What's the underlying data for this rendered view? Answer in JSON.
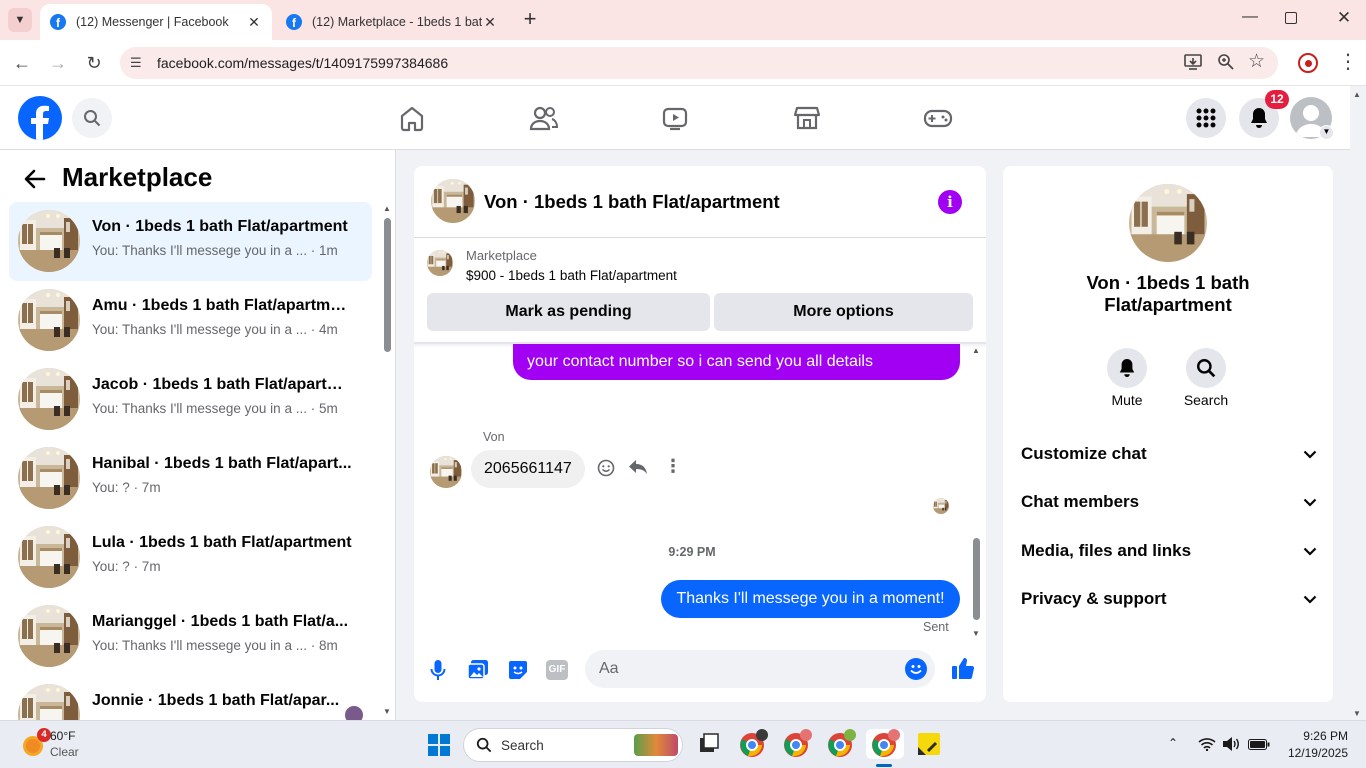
{
  "browser": {
    "tabs": [
      {
        "title": "(12) Messenger | Facebook",
        "active": true
      },
      {
        "title": "(12) Marketplace - 1beds 1 bath",
        "active": false
      }
    ],
    "url": "facebook.com/messages/t/1409175997384686"
  },
  "fb_header": {
    "notification_count": "12"
  },
  "left": {
    "title": "Marketplace",
    "conversations": [
      {
        "name": "Von · 1beds 1 bath Flat/apartment",
        "preview": "You: Thanks I'll messege you in a ...",
        "time": "· 1m"
      },
      {
        "name": "Amu · 1beds 1 bath Flat/apartment",
        "preview": "You: Thanks I'll messege you in a ...",
        "time": "· 4m"
      },
      {
        "name": "Jacob · 1beds 1 bath Flat/apartm...",
        "preview": "You: Thanks I'll messege you in a ...",
        "time": "· 5m"
      },
      {
        "name": "Hanibal · 1beds 1 bath Flat/apart...",
        "preview": "You: ?",
        "time": "· 7m"
      },
      {
        "name": "Lula · 1beds 1 bath Flat/apartment",
        "preview": "You: ?",
        "time": "· 7m"
      },
      {
        "name": "Marianggel · 1beds 1 bath Flat/a...",
        "preview": "You: Thanks I'll messege you in a ...",
        "time": "· 8m"
      },
      {
        "name": "Jonnie · 1beds 1 bath Flat/apar...",
        "preview": "",
        "time": ""
      }
    ]
  },
  "chat": {
    "title": "Von · 1beds 1 bath Flat/apartment",
    "listing_label": "Marketplace",
    "listing_title": "$900 - 1beds 1 bath Flat/apartment",
    "mark_pending": "Mark as pending",
    "more_options": "More options",
    "sent_msg_partial": "your contact number so i can send you all details",
    "sender_name": "Von",
    "received_msg": "2065661147",
    "timestamp": "9:29 PM",
    "last_msg": "Thanks I'll messege you in a moment!",
    "status": "Sent",
    "input_placeholder": "Aa"
  },
  "right": {
    "name": "Von · 1beds 1 bath Flat/apartment",
    "mute": "Mute",
    "search": "Search",
    "sections": [
      "Customize chat",
      "Chat members",
      "Media, files and links",
      "Privacy & support"
    ]
  },
  "taskbar": {
    "temp": "60°F",
    "weather": "Clear",
    "weather_badge": "4",
    "search": "Search",
    "time": "9:26 PM",
    "date": "12/19/2025"
  },
  "colors": {
    "fb_blue": "#1877f2",
    "messenger_purple": "#a100f2",
    "own_bubble": "#0866ff",
    "notification_red": "#e41e3f"
  }
}
